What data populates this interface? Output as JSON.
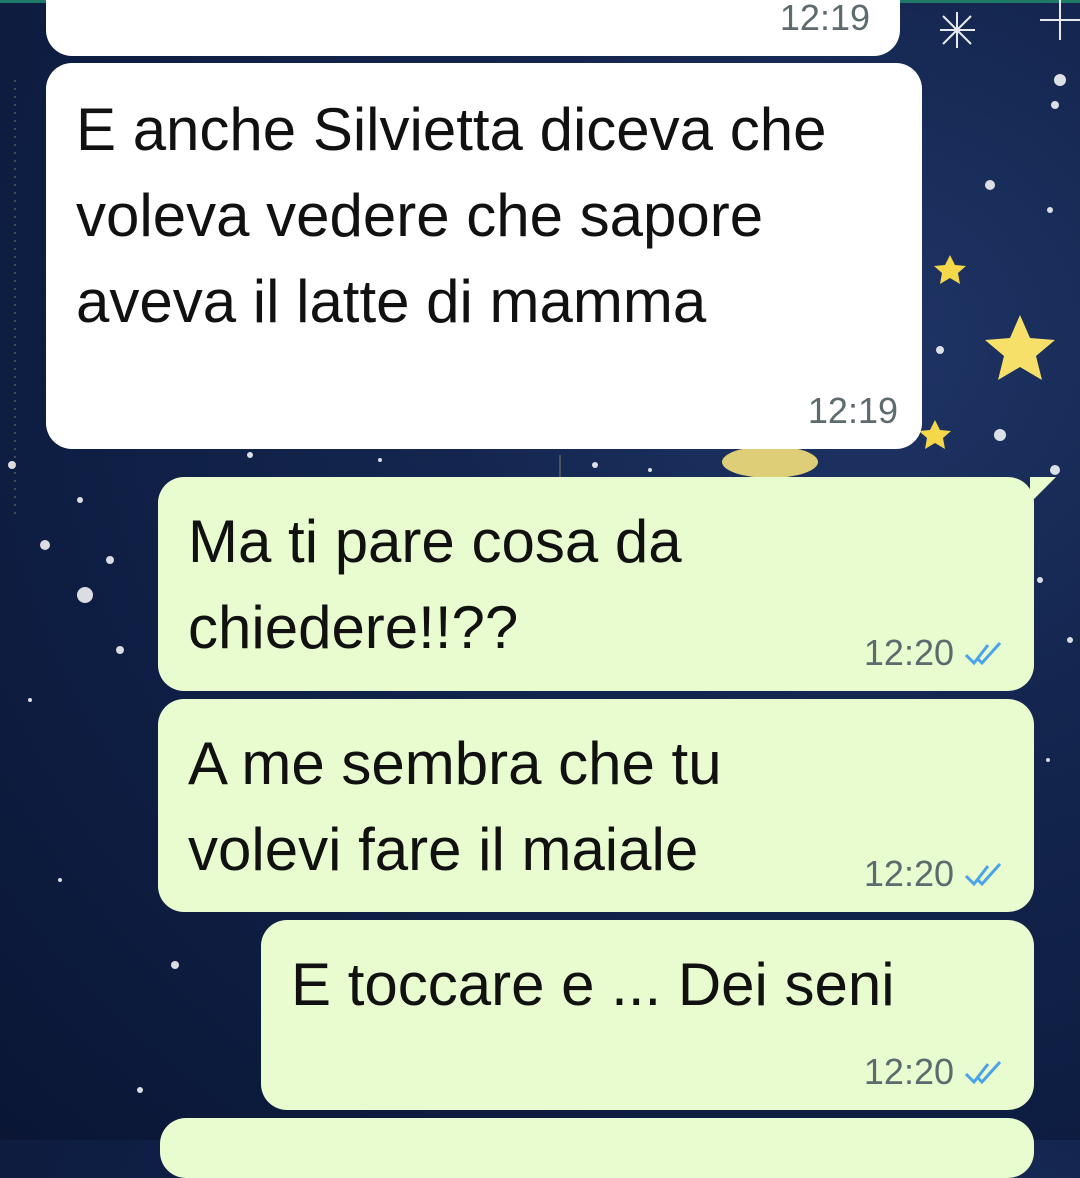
{
  "messages": [
    {
      "direction": "incoming",
      "text": "",
      "time": "12:19"
    },
    {
      "direction": "incoming",
      "text": "E anche Silvietta diceva che voleva vedere che sapore aveva il latte di mamma",
      "time": "12:19"
    },
    {
      "direction": "outgoing",
      "text": "Ma ti pare cosa da chiedere!!??",
      "time": "12:20",
      "status": "read-double-check-icon"
    },
    {
      "direction": "outgoing",
      "text": "A me sembra che tu volevi fare il maiale",
      "time": "12:20",
      "status": "read-double-check-icon"
    },
    {
      "direction": "outgoing",
      "text": "E toccare e ... Dei seni",
      "time": "12:20",
      "status": "read-double-check-icon"
    },
    {
      "direction": "outgoing",
      "text": "",
      "time": ""
    }
  ],
  "colors": {
    "incoming_bubble": "#ffffff",
    "outgoing_bubble": "#e8fcd0",
    "read_ticks": "#4aa3e8",
    "wallpaper": "#14264f"
  }
}
